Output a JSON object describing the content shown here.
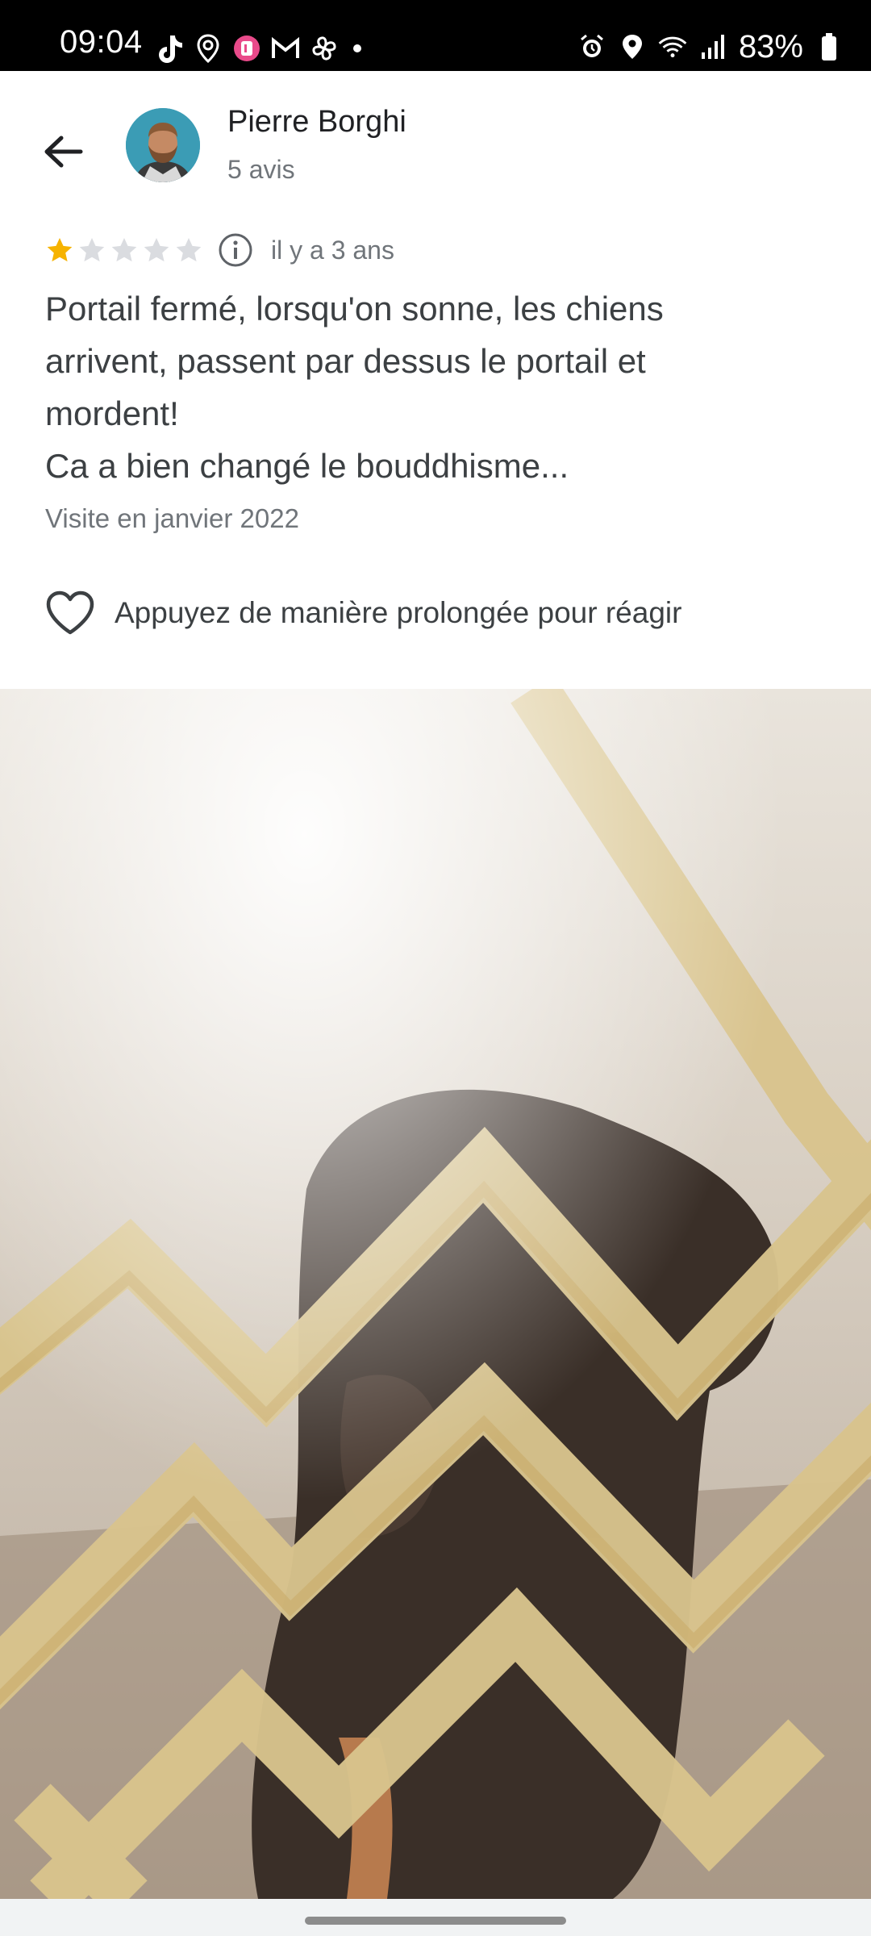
{
  "status_bar": {
    "time": "09:04",
    "left_icons": [
      "tiktok-icon",
      "location-pin-icon",
      "kiwi-app-icon",
      "gmail-icon",
      "fan-icon",
      "dot-icon"
    ],
    "right_icons": [
      "alarm-icon",
      "location-icon",
      "wifi-icon",
      "signal-icon",
      "battery-icon"
    ],
    "battery": "83%"
  },
  "review": {
    "author": {
      "name": "Pierre Borghi",
      "reviews_count": "5 avis"
    },
    "rating": 1,
    "rating_max": 5,
    "date": "il y a 3 ans",
    "text": "Portail fermé, lorsqu'on sonne, les chiens\narrivent, passent par dessus le portail et\nmordent!\nCa a bien changé le bouddhisme...",
    "visit": "Visite en janvier 2022",
    "react_label": "Appuyez de manière prolongée pour réagir"
  },
  "colors": {
    "star_filled": "#f6b300",
    "star_empty": "#dadce0",
    "text_primary": "#202124",
    "text_secondary": "#70757a"
  }
}
